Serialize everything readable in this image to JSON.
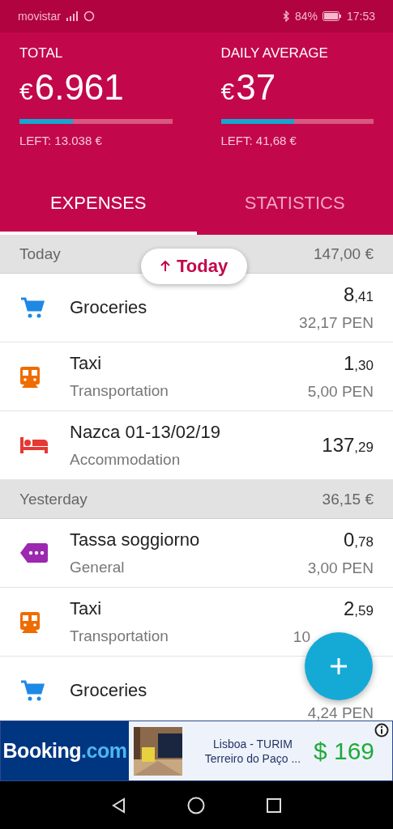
{
  "status_bar": {
    "carrier": "movistar",
    "battery": "84%",
    "time": "17:53"
  },
  "summary": [
    {
      "label": "TOTAL",
      "currency": "€",
      "value": "6.961",
      "level": 0.35,
      "left": "LEFT: 13.038 €"
    },
    {
      "label": "DAILY AVERAGE",
      "currency": "€",
      "value": "37",
      "level": 0.48,
      "left": "LEFT: 41,68 €"
    }
  ],
  "tabs": [
    {
      "label": "EXPENSES",
      "selected": true
    },
    {
      "label": "STATISTICS",
      "selected": false
    }
  ],
  "jump_chip": {
    "label": "Today"
  },
  "sections": [
    {
      "title": "Today",
      "total": "147,00 €",
      "items": [
        {
          "kind": "cart",
          "name": "Groceries",
          "amount": "8",
          "cents": ",41",
          "secondary": "32,17 PEN"
        },
        {
          "kind": "train",
          "name": "Taxi",
          "category": "Transportation",
          "amount": "1",
          "cents": ",30",
          "secondary": "5,00 PEN"
        },
        {
          "kind": "bed",
          "name": "Nazca 01-13/02/19",
          "category": "Accommodation",
          "amount": "137",
          "cents": ",29"
        }
      ]
    },
    {
      "title": "Yesterday",
      "total": "36,15 €",
      "items": [
        {
          "kind": "tag",
          "name": "Tassa soggiorno",
          "category": "General",
          "amount": "0",
          "cents": ",78",
          "secondary": "3,00 PEN"
        },
        {
          "kind": "train",
          "name": "Taxi",
          "category": "Transportation",
          "amount": "2",
          "cents": ",59",
          "secondary": "10",
          "covered": true
        },
        {
          "kind": "cart",
          "name": "Groceries",
          "secondary": "4,24 PEN"
        }
      ]
    }
  ],
  "ad": {
    "brand": "Booking",
    "brand_suffix": ".com",
    "title": "Lisboa - TURIM",
    "subtitle": "Terreiro do Paço ...",
    "price": "$ 169"
  }
}
